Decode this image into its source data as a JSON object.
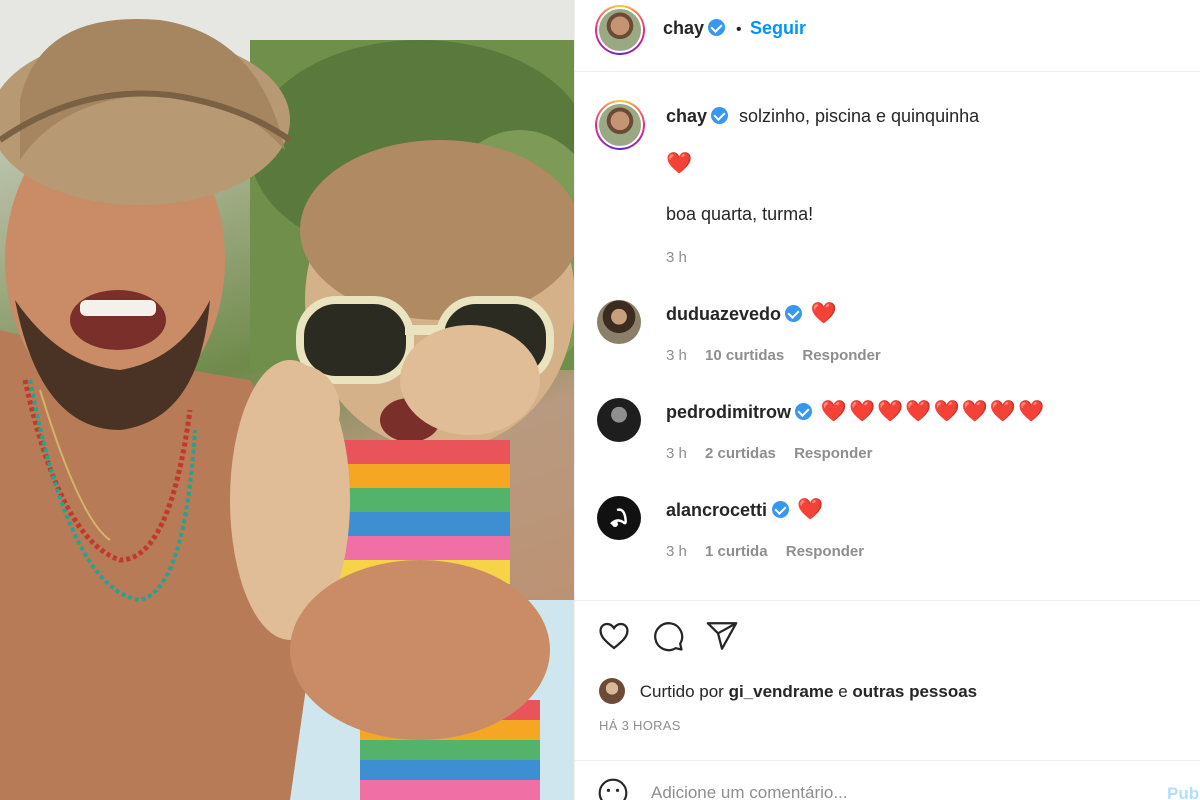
{
  "post_author": {
    "username": "chay",
    "verified": true,
    "follow_label": "Seguir",
    "separator": "•"
  },
  "caption": {
    "username": "chay",
    "text": "solzinho, piscina e quinquinha",
    "line2": "❤️",
    "line3": "boa quarta, turma!",
    "time": "3 h"
  },
  "comments": [
    {
      "username": "duduazevedo",
      "text": "❤️",
      "time": "3 h",
      "likes": "10 curtidas",
      "reply": "Responder"
    },
    {
      "username": "pedrodimitrow",
      "text": "❤️❤️❤️❤️❤️❤️❤️❤️",
      "time": "3 h",
      "likes": "2 curtidas",
      "reply": "Responder"
    },
    {
      "username": "alancrocetti",
      "text": "❤️",
      "time": "3 h",
      "likes": "1 curtida",
      "reply": "Responder"
    }
  ],
  "actions": {
    "like_icon": "heart-icon",
    "comment_icon": "comment-icon",
    "share_icon": "send-icon"
  },
  "liked_by": {
    "prefix": "Curtido por",
    "user": "gi_vendrame",
    "connector": "e",
    "others": "outras pessoas"
  },
  "time_ago": "HÁ 3 HORAS",
  "comment_box": {
    "placeholder": "Adicione um comentário...",
    "publish_label": "Publicar",
    "emoji_icon": "emoji-icon"
  },
  "colors": {
    "link": "#0095f6",
    "verified": "#3897f0",
    "heart": "#e0162b",
    "muted": "#8e8e8e"
  }
}
